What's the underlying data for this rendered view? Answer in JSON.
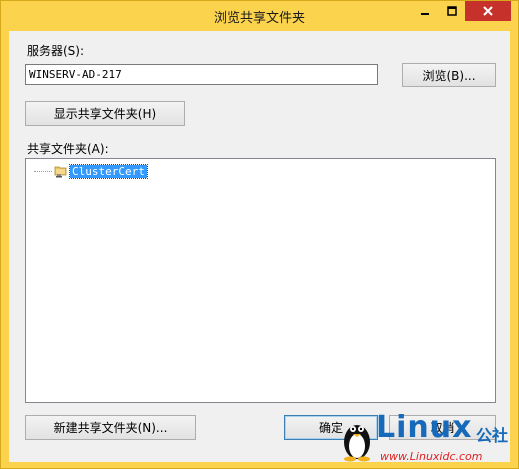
{
  "window": {
    "title": "浏览共享文件夹",
    "frame_color": "#fbd34d",
    "close_color": "#c7312b"
  },
  "server": {
    "label": "服务器(S):",
    "value": "WINSERV-AD-217",
    "browse_button": "浏览(B)..."
  },
  "show_shares_button": "显示共享文件夹(H)",
  "shares": {
    "label": "共享文件夹(A):",
    "items": [
      {
        "label": "ClusterCert",
        "icon": "shared-folder-icon",
        "selected": true
      }
    ]
  },
  "footer": {
    "new_share_button": "新建共享文件夹(N)...",
    "ok_button": "确定",
    "cancel_button": "取消"
  },
  "watermark": {
    "brand": "Linux",
    "brand_cn": "公社",
    "url": "www.Linuxidc.com"
  }
}
